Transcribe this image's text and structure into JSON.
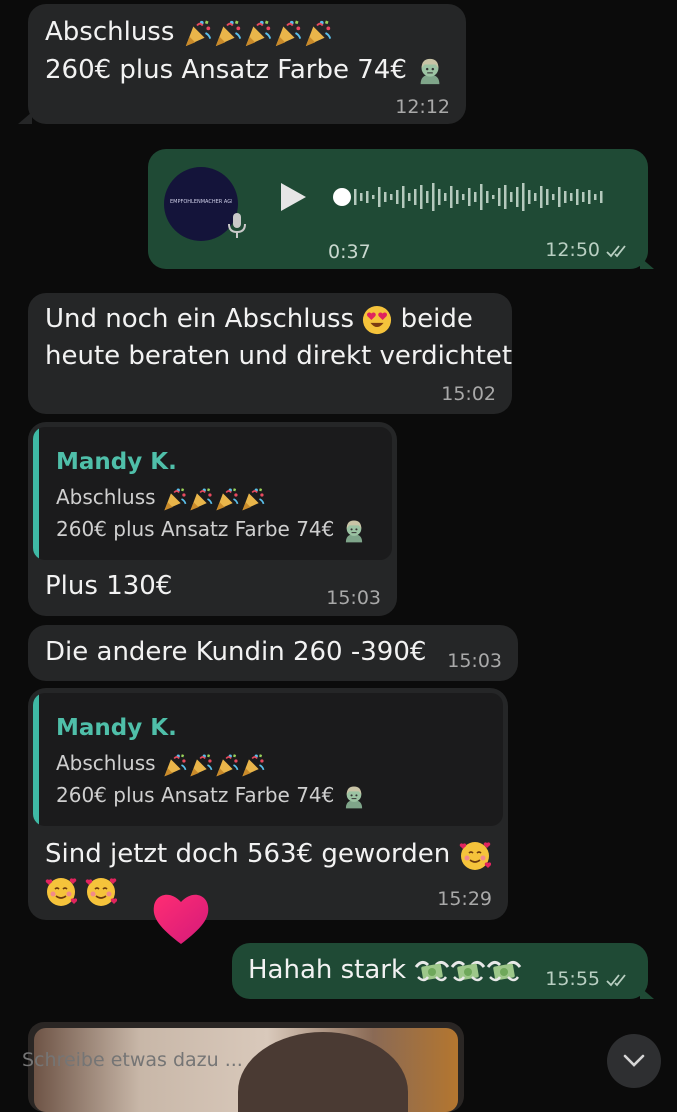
{
  "messages": {
    "m1": {
      "line1": "Abschluss",
      "line2": "260€ plus Ansatz Farbe 74€",
      "time": "12:12"
    },
    "voice": {
      "avatar_text": "EMPFOHLENMACHER AGENCY",
      "duration": "0:37",
      "time": "12:50"
    },
    "m2": {
      "line1": "Und noch ein Abschluss",
      "line1b": "beide",
      "line2": "heute beraten und direkt verdichtet",
      "time": "15:02"
    },
    "m3": {
      "quote_name": "Mandy K.",
      "quote_line1": "Abschluss",
      "quote_line2": "260€ plus Ansatz Farbe 74€",
      "text": "Plus 130€",
      "time": "15:03"
    },
    "m4": {
      "text": "Die andere Kundin 260 -390€",
      "time": "15:03"
    },
    "m5": {
      "quote_name": "Mandy K.",
      "quote_line1": "Abschluss",
      "quote_line2": "260€ plus Ansatz Farbe 74€",
      "text": "Sind jetzt doch 563€ geworden",
      "time": "15:29"
    },
    "m6": {
      "text": "Hahah stark",
      "time": "15:55"
    }
  },
  "composer": {
    "placeholder": "Schreibe etwas dazu ..."
  },
  "icons": [
    "party-popper-icon",
    "woman-zombie-icon",
    "heart-eyes-icon",
    "smiling-hearts-icon",
    "money-wings-icon",
    "play-icon",
    "mic-icon",
    "double-check-icon",
    "heart-reaction-icon",
    "chevron-down-icon"
  ],
  "colors": {
    "incoming": "#252627",
    "outgoing": "#1f4a35",
    "quote_accent": "#3fb9a5",
    "background": "#0b0b0b"
  }
}
